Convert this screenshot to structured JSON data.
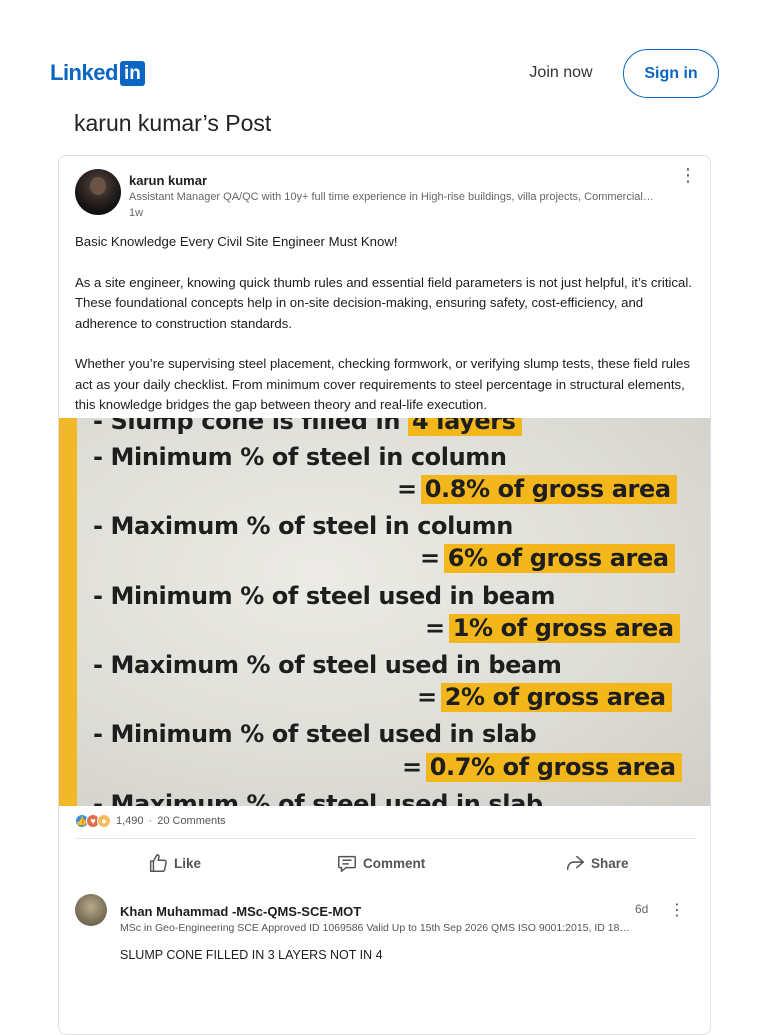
{
  "header": {
    "logo_text": "Linked",
    "logo_box": "in",
    "join_label": "Join now",
    "signin_label": "Sign in"
  },
  "page_title": "karun kumar’s Post",
  "post": {
    "author_name": "karun kumar",
    "author_headline": "Assistant Manager QA/QC with 10y+ full time experience in High-rise buildings, villa projects, Commercial…",
    "time": "1w",
    "paragraphs": [
      "Basic Knowledge Every Civil Site Engineer Must Know!",
      "As a site engineer, knowing quick thumb rules and essential field parameters is not just helpful, it’s critical. These foundational concepts help in on-site decision-making, ensuring safety, cost-efficiency, and adherence to construction standards.",
      "Whether you’re supervising steel placement, checking formwork, or verifying slump tests, these field rules act as your daily checklist. From minimum cover requirements to steel percentage in structural elements, this knowledge bridges the gap between theory and real-life execution."
    ],
    "image": {
      "top_partial": "- Slump cone is filled in",
      "top_partial_value": "4 layers",
      "rows": [
        {
          "label": "- Minimum % of steel in column",
          "value": "0.8% of gross area"
        },
        {
          "label": "- Maximum % of steel in column",
          "value": "6% of gross area"
        },
        {
          "label": "- Minimum % of steel used in beam",
          "value": "1% of gross area"
        },
        {
          "label": "- Maximum % of steel used in beam",
          "value": "2% of gross area"
        },
        {
          "label": "- Minimum % of steel used in slab",
          "value": "0.7% of gross area"
        }
      ],
      "bottom_partial": "- Maximum % of steel used in slab",
      "equals": "="
    },
    "reactions": {
      "count": "1,490",
      "separator": "·",
      "comments": "20 Comments"
    },
    "actions": {
      "like": "Like",
      "comment": "Comment",
      "share": "Share"
    }
  },
  "comment": {
    "name": "Khan Muhammad -MSc-QMS-SCE-MOT",
    "headline": "MSc in Geo-Engineering SCE Approved ID 1069586 Valid Up to 15th Sep 2026 QMS ISO 9001:2015, ID 18…",
    "time": "6d",
    "text": "SLUMP CONE FILLED IN 3 LAYERS NOT IN 4"
  },
  "colors": {
    "brand": "#0a66c2",
    "highlight": "#f3b71c"
  }
}
